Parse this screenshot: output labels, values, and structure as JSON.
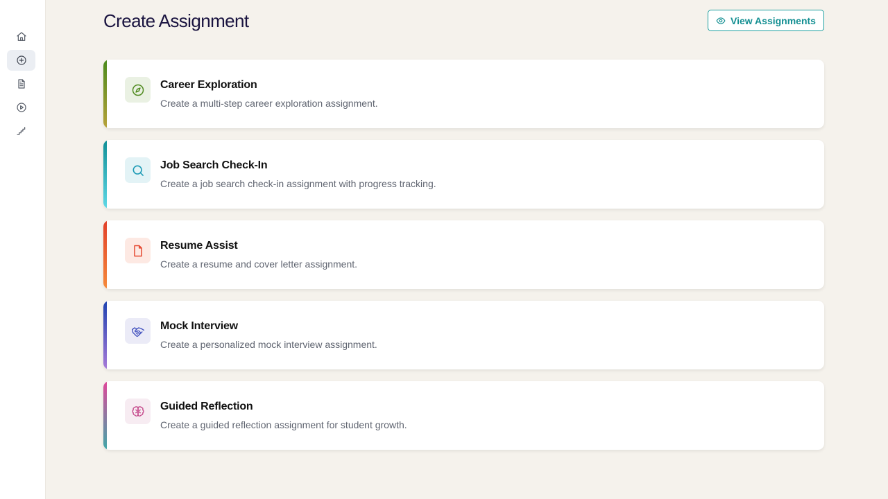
{
  "sidebar": {
    "items": [
      {
        "name": "home",
        "icon": "home-icon"
      },
      {
        "name": "create",
        "icon": "plus-circle-icon",
        "active": true
      },
      {
        "name": "documents",
        "icon": "document-icon"
      },
      {
        "name": "play",
        "icon": "play-circle-icon"
      },
      {
        "name": "steps",
        "icon": "stairs-icon"
      }
    ]
  },
  "header": {
    "title": "Create Assignment",
    "view_button_label": "View Assignments"
  },
  "colors": {
    "title": "#1a1440",
    "teal": "#138f92",
    "background": "#f5f2ec"
  },
  "cards": [
    {
      "title": "Career Exploration",
      "description": "Create a multi-step career exploration assignment.",
      "icon": "compass-icon",
      "accent_top": "#4a8a1c",
      "accent_bottom": "#b7a23a",
      "icon_bg": "#eaf1e3",
      "icon_color": "#4f8a1f"
    },
    {
      "title": "Job Search Check-In",
      "description": "Create a job search check-in assignment with progress tracking.",
      "icon": "search-icon",
      "accent_top": "#118f96",
      "accent_bottom": "#5ed8e6",
      "icon_bg": "#e3f3f6",
      "icon_color": "#1b9ab5"
    },
    {
      "title": "Resume Assist",
      "description": "Create a resume and cover letter assignment.",
      "icon": "document-icon",
      "accent_top": "#e2402a",
      "accent_bottom": "#f58a3a",
      "icon_bg": "#fde9e3",
      "icon_color": "#e5472f"
    },
    {
      "title": "Mock Interview",
      "description": "Create a personalized mock interview assignment.",
      "icon": "handshake-icon",
      "accent_top": "#1e43b0",
      "accent_bottom": "#a77ad8",
      "icon_bg": "#ebebf7",
      "icon_color": "#4756c0"
    },
    {
      "title": "Guided Reflection",
      "description": "Create a guided reflection assignment for student growth.",
      "icon": "brain-icon",
      "accent_top": "#e0479a",
      "accent_bottom": "#3fa8a8",
      "icon_bg": "#f7ecf2",
      "icon_color": "#c4478a"
    }
  ]
}
